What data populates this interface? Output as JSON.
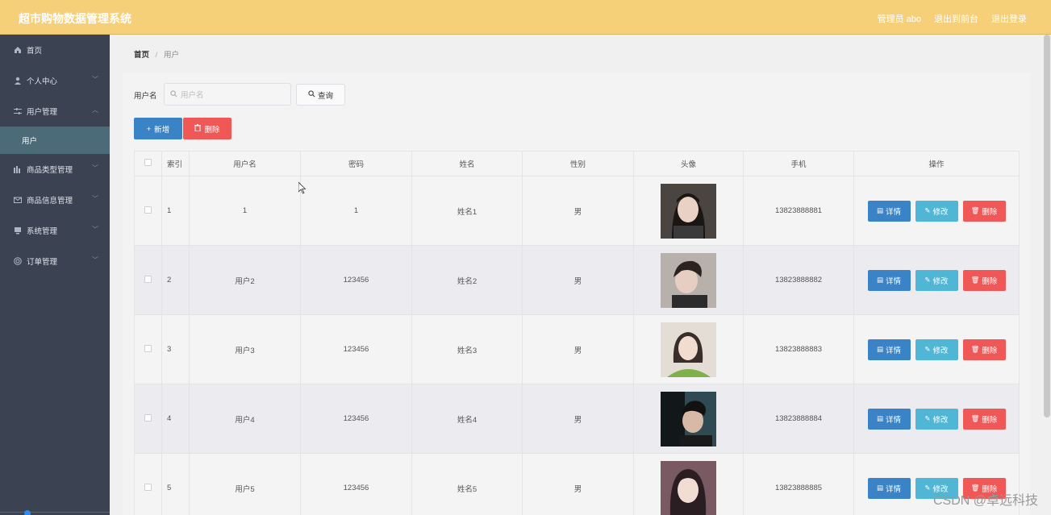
{
  "header": {
    "title": "超市购物数据管理系统",
    "admin": "管理员 abo",
    "back_to_home": "退出到前台",
    "logout": "退出登录"
  },
  "sidebar": {
    "items": [
      {
        "label": "首页",
        "icon": "home-icon"
      },
      {
        "label": "个人中心",
        "icon": "user-icon"
      },
      {
        "label": "用户管理",
        "icon": "sliders-icon"
      },
      {
        "label": "商品类型管理",
        "icon": "chart-icon"
      },
      {
        "label": "商品信息管理",
        "icon": "mail-icon"
      },
      {
        "label": "系统管理",
        "icon": "monitor-icon"
      },
      {
        "label": "订单管理",
        "icon": "globe-icon"
      }
    ],
    "subitem": "用户"
  },
  "breadcrumb": {
    "home": "首页",
    "separator": "/",
    "current": "用户"
  },
  "search": {
    "label": "用户名",
    "placeholder": "用户名",
    "button": "查询"
  },
  "actions": {
    "add": "新增",
    "delete": "删除"
  },
  "table": {
    "columns": [
      "索引",
      "用户名",
      "密码",
      "姓名",
      "性别",
      "头像",
      "手机",
      "操作"
    ],
    "rows": [
      {
        "index": "1",
        "username": "1",
        "password": "1",
        "name": "姓名1",
        "gender": "男",
        "phone": "13823888881"
      },
      {
        "index": "2",
        "username": "用户2",
        "password": "123456",
        "name": "姓名2",
        "gender": "男",
        "phone": "13823888882"
      },
      {
        "index": "3",
        "username": "用户3",
        "password": "123456",
        "name": "姓名3",
        "gender": "男",
        "phone": "13823888883"
      },
      {
        "index": "4",
        "username": "用户4",
        "password": "123456",
        "name": "姓名4",
        "gender": "男",
        "phone": "13823888884"
      },
      {
        "index": "5",
        "username": "用户5",
        "password": "123456",
        "name": "姓名5",
        "gender": "男",
        "phone": "13823888885"
      }
    ],
    "row_actions": {
      "detail": "详情",
      "edit": "修改",
      "delete": "删除"
    }
  },
  "watermark": "CSDN @卓远科技",
  "colors": {
    "header_bg": "#f5d078",
    "sidebar_bg": "#3b4252",
    "submenu_active_bg": "#4b6b79",
    "primary": "#3b83c7",
    "info": "#4fb6d6",
    "danger": "#f05858"
  }
}
